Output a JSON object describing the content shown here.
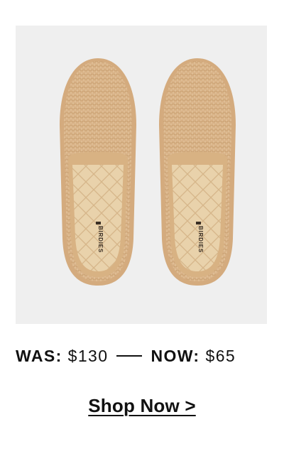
{
  "product": {
    "image_description_icon": "loafer-pair-photo",
    "brand_insole_text": "BIRDIES"
  },
  "pricing": {
    "was_label": "WAS:",
    "was_value": "$130",
    "now_label": "NOW:",
    "now_value": "$65"
  },
  "cta": {
    "label": "Shop Now >"
  },
  "colors": {
    "photo_background": "#efefef",
    "woven_straw": "#d9b48b",
    "insole": "#e8cfa6",
    "text": "#111111"
  }
}
